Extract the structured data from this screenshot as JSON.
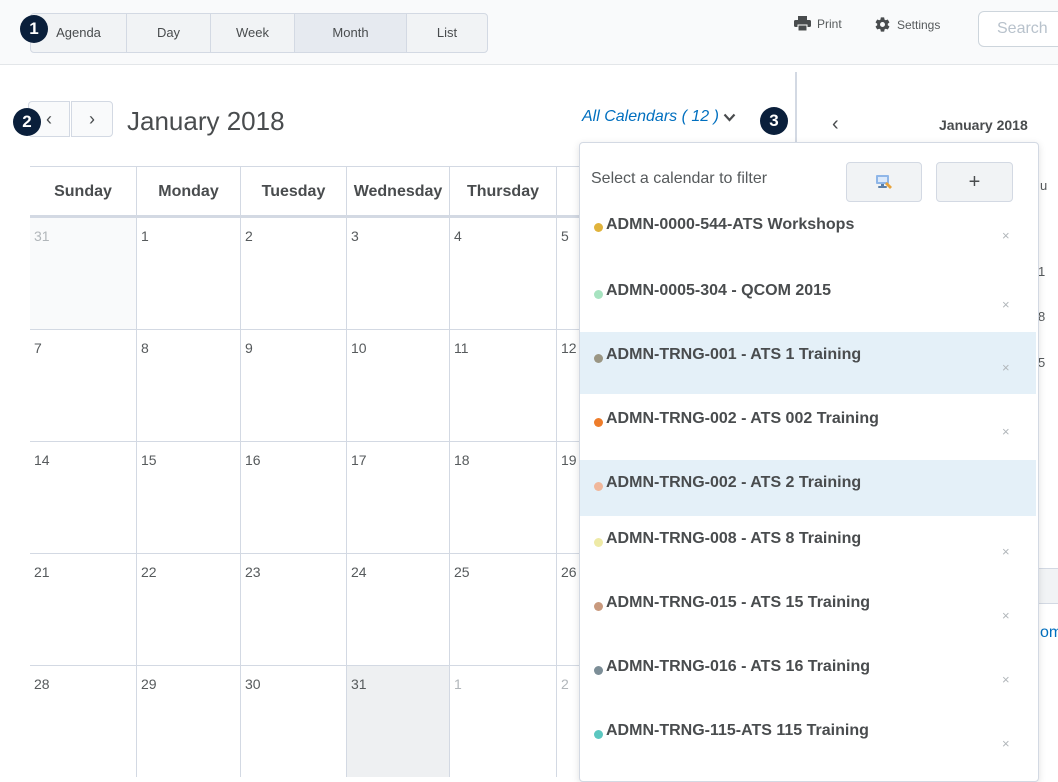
{
  "toolbar": {
    "tabs": [
      {
        "label": "Agenda",
        "active": false
      },
      {
        "label": "Day",
        "active": false
      },
      {
        "label": "Week",
        "active": false
      },
      {
        "label": "Month",
        "active": true
      },
      {
        "label": "List",
        "active": false
      }
    ],
    "print_label": "Print",
    "settings_label": "Settings",
    "search_placeholder": "Search"
  },
  "badges": [
    "1",
    "2",
    "3"
  ],
  "calendar": {
    "prev_icon": "‹",
    "next_icon": "›",
    "month_title": "January 2018",
    "all_calendars_label": "All Calendars ( 12 )",
    "day_headers": [
      "Sunday",
      "Monday",
      "Tuesday",
      "Wednesday",
      "Thursday",
      ""
    ],
    "weeks": [
      [
        "31",
        "1",
        "2",
        "3",
        "4",
        "5"
      ],
      [
        "7",
        "8",
        "9",
        "10",
        "11",
        "12"
      ],
      [
        "14",
        "15",
        "16",
        "17",
        "18",
        "19"
      ],
      [
        "21",
        "22",
        "23",
        "24",
        "25",
        "26"
      ],
      [
        "28",
        "29",
        "30",
        "31",
        "1",
        "2"
      ]
    ]
  },
  "mini_calendar": {
    "title": "January 2018",
    "prev_icon": "‹",
    "fragments": [
      "u",
      "1",
      "8",
      "5",
      "om"
    ]
  },
  "filter_dropdown": {
    "header": "Select a calendar to filter",
    "add_label": "+",
    "remove_icon": "×",
    "items": [
      {
        "label": "ADMN-0000-544-ATS Workshops",
        "color": "#e0b33c",
        "highlighted": false,
        "removable": true
      },
      {
        "label": "ADMN-0005-304 - QCOM 2015",
        "color": "#a7e3c0",
        "highlighted": false,
        "removable": true
      },
      {
        "label": "ADMN-TRNG-001 - ATS 1 Training",
        "color": "#9a9684",
        "highlighted": true,
        "removable": true
      },
      {
        "label": "ADMN-TRNG-002 - ATS 002 Training",
        "color": "#ee7d2b",
        "highlighted": false,
        "removable": true
      },
      {
        "label": "ADMN-TRNG-002 - ATS 2 Training",
        "color": "#f0b79b",
        "highlighted": true,
        "removable": false
      },
      {
        "label": "ADMN-TRNG-008 - ATS 8 Training",
        "color": "#eeeaa6",
        "highlighted": false,
        "removable": true
      },
      {
        "label": "ADMN-TRNG-015 - ATS 15 Training",
        "color": "#c99a7e",
        "highlighted": false,
        "removable": true
      },
      {
        "label": "ADMN-TRNG-016 - ATS 16 Training",
        "color": "#7c8e97",
        "highlighted": false,
        "removable": true
      },
      {
        "label": "ADMN-TRNG-115-ATS 115 Training",
        "color": "#5cc7c0",
        "highlighted": false,
        "removable": true
      }
    ]
  }
}
